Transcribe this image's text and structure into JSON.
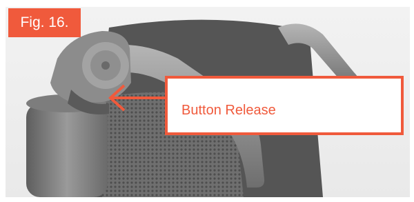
{
  "figure": {
    "label": "Fig. 16.",
    "callout_text": "Button Release"
  },
  "colors": {
    "accent": "#f05a3c",
    "photo_tone": "#8a8a8a"
  },
  "icons": {
    "arrow": "arrow-left-icon"
  }
}
